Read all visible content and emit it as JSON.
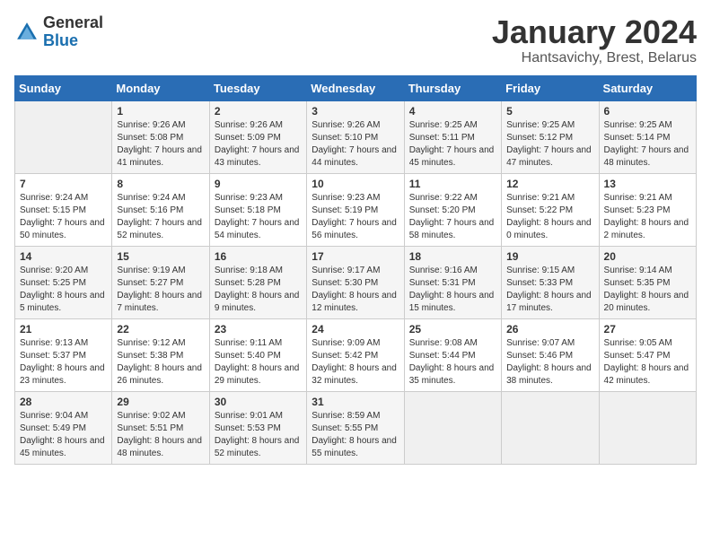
{
  "header": {
    "logo_general": "General",
    "logo_blue": "Blue",
    "month_title": "January 2024",
    "subtitle": "Hantsavichy, Brest, Belarus"
  },
  "weekdays": [
    "Sunday",
    "Monday",
    "Tuesday",
    "Wednesday",
    "Thursday",
    "Friday",
    "Saturday"
  ],
  "weeks": [
    [
      {
        "num": "",
        "sunrise": "",
        "sunset": "",
        "daylight": ""
      },
      {
        "num": "1",
        "sunrise": "Sunrise: 9:26 AM",
        "sunset": "Sunset: 5:08 PM",
        "daylight": "Daylight: 7 hours and 41 minutes."
      },
      {
        "num": "2",
        "sunrise": "Sunrise: 9:26 AM",
        "sunset": "Sunset: 5:09 PM",
        "daylight": "Daylight: 7 hours and 43 minutes."
      },
      {
        "num": "3",
        "sunrise": "Sunrise: 9:26 AM",
        "sunset": "Sunset: 5:10 PM",
        "daylight": "Daylight: 7 hours and 44 minutes."
      },
      {
        "num": "4",
        "sunrise": "Sunrise: 9:25 AM",
        "sunset": "Sunset: 5:11 PM",
        "daylight": "Daylight: 7 hours and 45 minutes."
      },
      {
        "num": "5",
        "sunrise": "Sunrise: 9:25 AM",
        "sunset": "Sunset: 5:12 PM",
        "daylight": "Daylight: 7 hours and 47 minutes."
      },
      {
        "num": "6",
        "sunrise": "Sunrise: 9:25 AM",
        "sunset": "Sunset: 5:14 PM",
        "daylight": "Daylight: 7 hours and 48 minutes."
      }
    ],
    [
      {
        "num": "7",
        "sunrise": "Sunrise: 9:24 AM",
        "sunset": "Sunset: 5:15 PM",
        "daylight": "Daylight: 7 hours and 50 minutes."
      },
      {
        "num": "8",
        "sunrise": "Sunrise: 9:24 AM",
        "sunset": "Sunset: 5:16 PM",
        "daylight": "Daylight: 7 hours and 52 minutes."
      },
      {
        "num": "9",
        "sunrise": "Sunrise: 9:23 AM",
        "sunset": "Sunset: 5:18 PM",
        "daylight": "Daylight: 7 hours and 54 minutes."
      },
      {
        "num": "10",
        "sunrise": "Sunrise: 9:23 AM",
        "sunset": "Sunset: 5:19 PM",
        "daylight": "Daylight: 7 hours and 56 minutes."
      },
      {
        "num": "11",
        "sunrise": "Sunrise: 9:22 AM",
        "sunset": "Sunset: 5:20 PM",
        "daylight": "Daylight: 7 hours and 58 minutes."
      },
      {
        "num": "12",
        "sunrise": "Sunrise: 9:21 AM",
        "sunset": "Sunset: 5:22 PM",
        "daylight": "Daylight: 8 hours and 0 minutes."
      },
      {
        "num": "13",
        "sunrise": "Sunrise: 9:21 AM",
        "sunset": "Sunset: 5:23 PM",
        "daylight": "Daylight: 8 hours and 2 minutes."
      }
    ],
    [
      {
        "num": "14",
        "sunrise": "Sunrise: 9:20 AM",
        "sunset": "Sunset: 5:25 PM",
        "daylight": "Daylight: 8 hours and 5 minutes."
      },
      {
        "num": "15",
        "sunrise": "Sunrise: 9:19 AM",
        "sunset": "Sunset: 5:27 PM",
        "daylight": "Daylight: 8 hours and 7 minutes."
      },
      {
        "num": "16",
        "sunrise": "Sunrise: 9:18 AM",
        "sunset": "Sunset: 5:28 PM",
        "daylight": "Daylight: 8 hours and 9 minutes."
      },
      {
        "num": "17",
        "sunrise": "Sunrise: 9:17 AM",
        "sunset": "Sunset: 5:30 PM",
        "daylight": "Daylight: 8 hours and 12 minutes."
      },
      {
        "num": "18",
        "sunrise": "Sunrise: 9:16 AM",
        "sunset": "Sunset: 5:31 PM",
        "daylight": "Daylight: 8 hours and 15 minutes."
      },
      {
        "num": "19",
        "sunrise": "Sunrise: 9:15 AM",
        "sunset": "Sunset: 5:33 PM",
        "daylight": "Daylight: 8 hours and 17 minutes."
      },
      {
        "num": "20",
        "sunrise": "Sunrise: 9:14 AM",
        "sunset": "Sunset: 5:35 PM",
        "daylight": "Daylight: 8 hours and 20 minutes."
      }
    ],
    [
      {
        "num": "21",
        "sunrise": "Sunrise: 9:13 AM",
        "sunset": "Sunset: 5:37 PM",
        "daylight": "Daylight: 8 hours and 23 minutes."
      },
      {
        "num": "22",
        "sunrise": "Sunrise: 9:12 AM",
        "sunset": "Sunset: 5:38 PM",
        "daylight": "Daylight: 8 hours and 26 minutes."
      },
      {
        "num": "23",
        "sunrise": "Sunrise: 9:11 AM",
        "sunset": "Sunset: 5:40 PM",
        "daylight": "Daylight: 8 hours and 29 minutes."
      },
      {
        "num": "24",
        "sunrise": "Sunrise: 9:09 AM",
        "sunset": "Sunset: 5:42 PM",
        "daylight": "Daylight: 8 hours and 32 minutes."
      },
      {
        "num": "25",
        "sunrise": "Sunrise: 9:08 AM",
        "sunset": "Sunset: 5:44 PM",
        "daylight": "Daylight: 8 hours and 35 minutes."
      },
      {
        "num": "26",
        "sunrise": "Sunrise: 9:07 AM",
        "sunset": "Sunset: 5:46 PM",
        "daylight": "Daylight: 8 hours and 38 minutes."
      },
      {
        "num": "27",
        "sunrise": "Sunrise: 9:05 AM",
        "sunset": "Sunset: 5:47 PM",
        "daylight": "Daylight: 8 hours and 42 minutes."
      }
    ],
    [
      {
        "num": "28",
        "sunrise": "Sunrise: 9:04 AM",
        "sunset": "Sunset: 5:49 PM",
        "daylight": "Daylight: 8 hours and 45 minutes."
      },
      {
        "num": "29",
        "sunrise": "Sunrise: 9:02 AM",
        "sunset": "Sunset: 5:51 PM",
        "daylight": "Daylight: 8 hours and 48 minutes."
      },
      {
        "num": "30",
        "sunrise": "Sunrise: 9:01 AM",
        "sunset": "Sunset: 5:53 PM",
        "daylight": "Daylight: 8 hours and 52 minutes."
      },
      {
        "num": "31",
        "sunrise": "Sunrise: 8:59 AM",
        "sunset": "Sunset: 5:55 PM",
        "daylight": "Daylight: 8 hours and 55 minutes."
      },
      {
        "num": "",
        "sunrise": "",
        "sunset": "",
        "daylight": ""
      },
      {
        "num": "",
        "sunrise": "",
        "sunset": "",
        "daylight": ""
      },
      {
        "num": "",
        "sunrise": "",
        "sunset": "",
        "daylight": ""
      }
    ]
  ]
}
